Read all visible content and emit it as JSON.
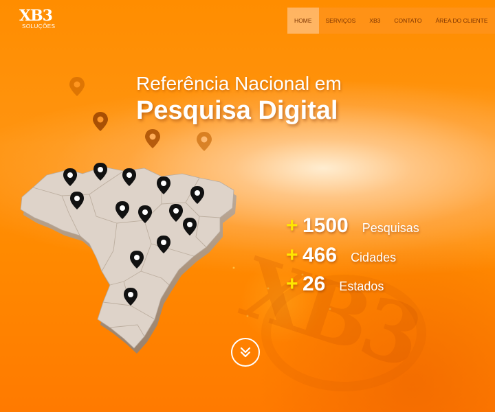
{
  "brand": {
    "logo_text": "XB3",
    "logo_subtitle": "SOLUÇÕES",
    "watermark_text": "XB3"
  },
  "nav": {
    "items": [
      {
        "label": "Home",
        "active": true
      },
      {
        "label": "Serviços",
        "active": false
      },
      {
        "label": "XB3",
        "active": false
      },
      {
        "label": "Contato",
        "active": false
      },
      {
        "label": "Área do Cliente",
        "active": false
      }
    ]
  },
  "hero": {
    "headline_line1": "Referência Nacional em",
    "headline_line2": "Pesquisa Digital"
  },
  "stats": [
    {
      "plus": "+",
      "value": "1500",
      "label": "Pesquisas"
    },
    {
      "plus": "+",
      "value": "466",
      "label": "Cidades"
    },
    {
      "plus": "+",
      "value": "26",
      "label": "Estados"
    }
  ],
  "map": {
    "marker_count": 15,
    "floating_marker_count": 4
  },
  "scroll_button": {
    "icon": "double-chevron-down-icon"
  },
  "colors": {
    "background": "#ff8a00",
    "accent_plus": "#ffe600",
    "text": "#ffffff",
    "nav_text": "#7a3200",
    "map_fill": "#ddd1c6",
    "pin": "#111111",
    "pin_faded": "#b85a00"
  }
}
